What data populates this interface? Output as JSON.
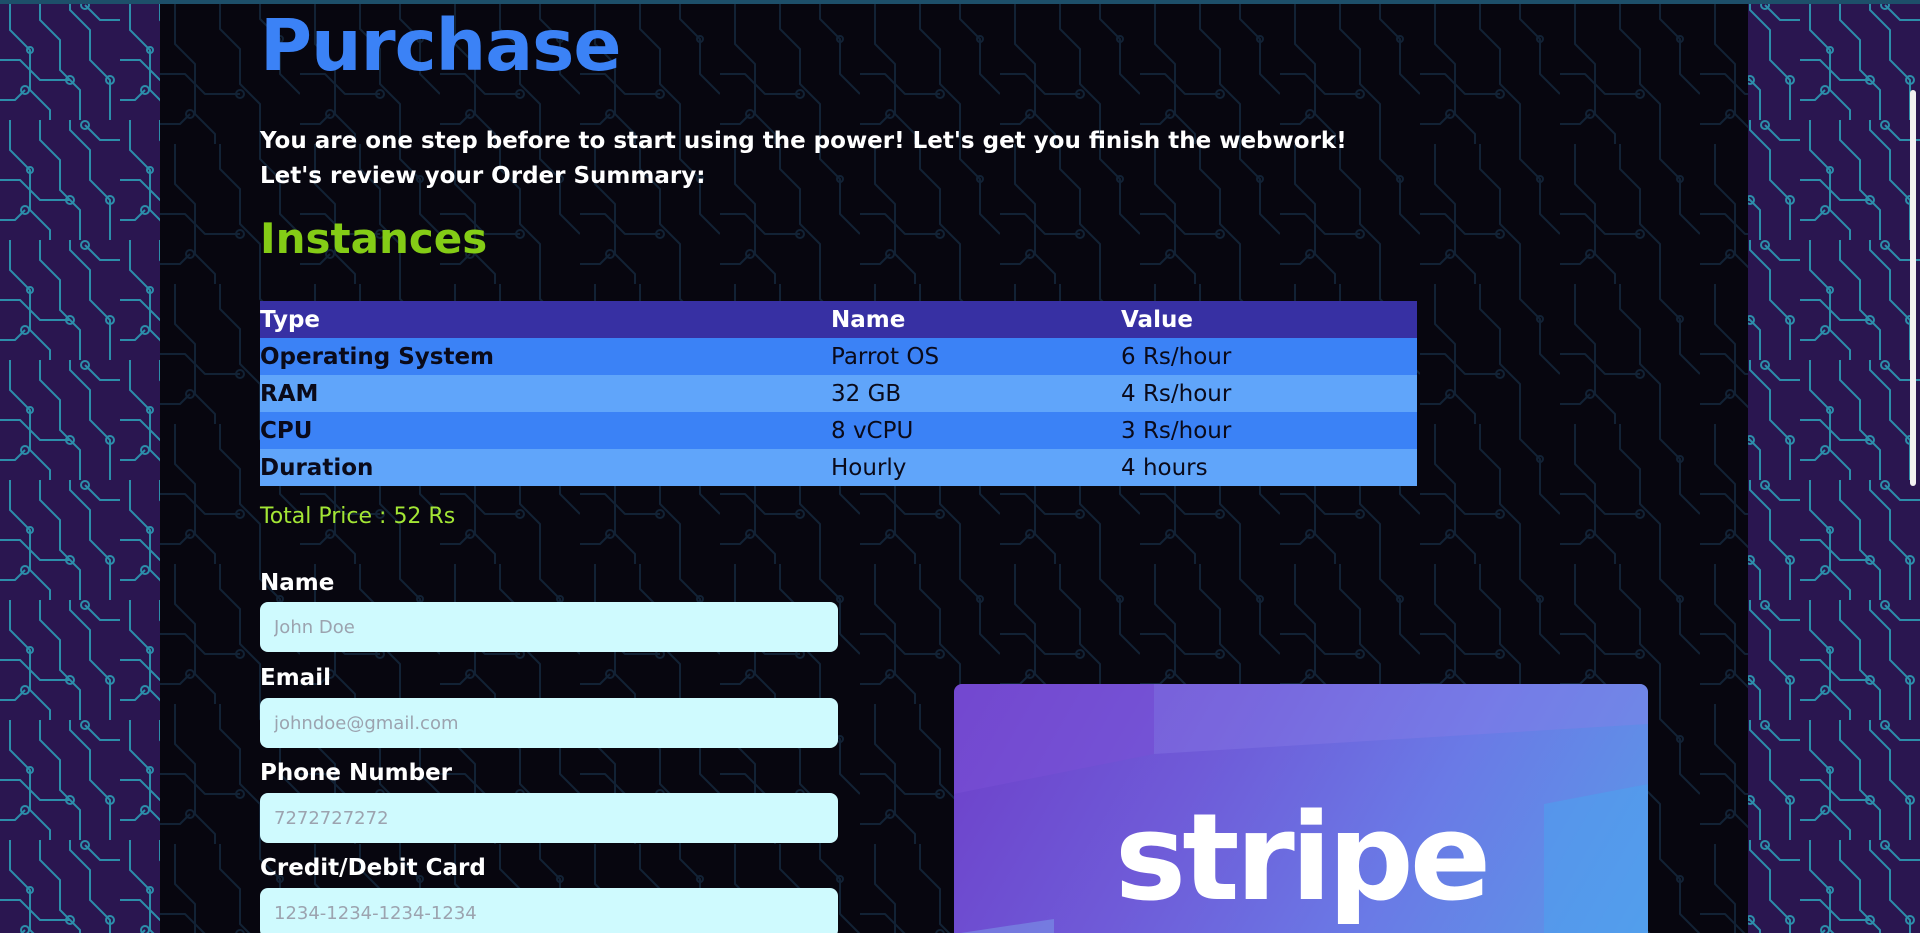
{
  "page": {
    "title": "Purchase",
    "intro_line1": "You are one step before to start using the power! Let's get you finish the webwork!",
    "intro_line2": "Let's review your Order Summary:"
  },
  "instances": {
    "heading": "Instances",
    "columns": [
      "Type",
      "Name",
      "Value"
    ],
    "rows": [
      {
        "type": "Operating System",
        "name": "Parrot OS",
        "value": "6 Rs/hour"
      },
      {
        "type": "RAM",
        "name": "32 GB",
        "value": "4 Rs/hour"
      },
      {
        "type": "CPU",
        "name": "8 vCPU",
        "value": "3 Rs/hour"
      },
      {
        "type": "Duration",
        "name": "Hourly",
        "value": "4 hours"
      }
    ],
    "total": "Total Price : 52 Rs"
  },
  "form": {
    "name_label": "Name",
    "name_placeholder": "John Doe",
    "email_label": "Email",
    "email_placeholder": "johndoe@gmail.com",
    "phone_label": "Phone Number",
    "phone_placeholder": "7272727272",
    "card_label": "Credit/Debit Card",
    "card_placeholder": "1234-1234-1234-1234"
  },
  "stripe": {
    "logo_text": "stripe"
  },
  "colors": {
    "title": "#3b82f6",
    "instances_heading": "#84cc16",
    "total": "#a3e635",
    "table_header": "#3730a3",
    "row_dark": "#3b82f6",
    "row_light": "#60a5fa",
    "input_bg": "#cffafe",
    "panel_bg": "#07060f",
    "side_bg": "#2a1650",
    "circuit": "#2bb5c8"
  }
}
